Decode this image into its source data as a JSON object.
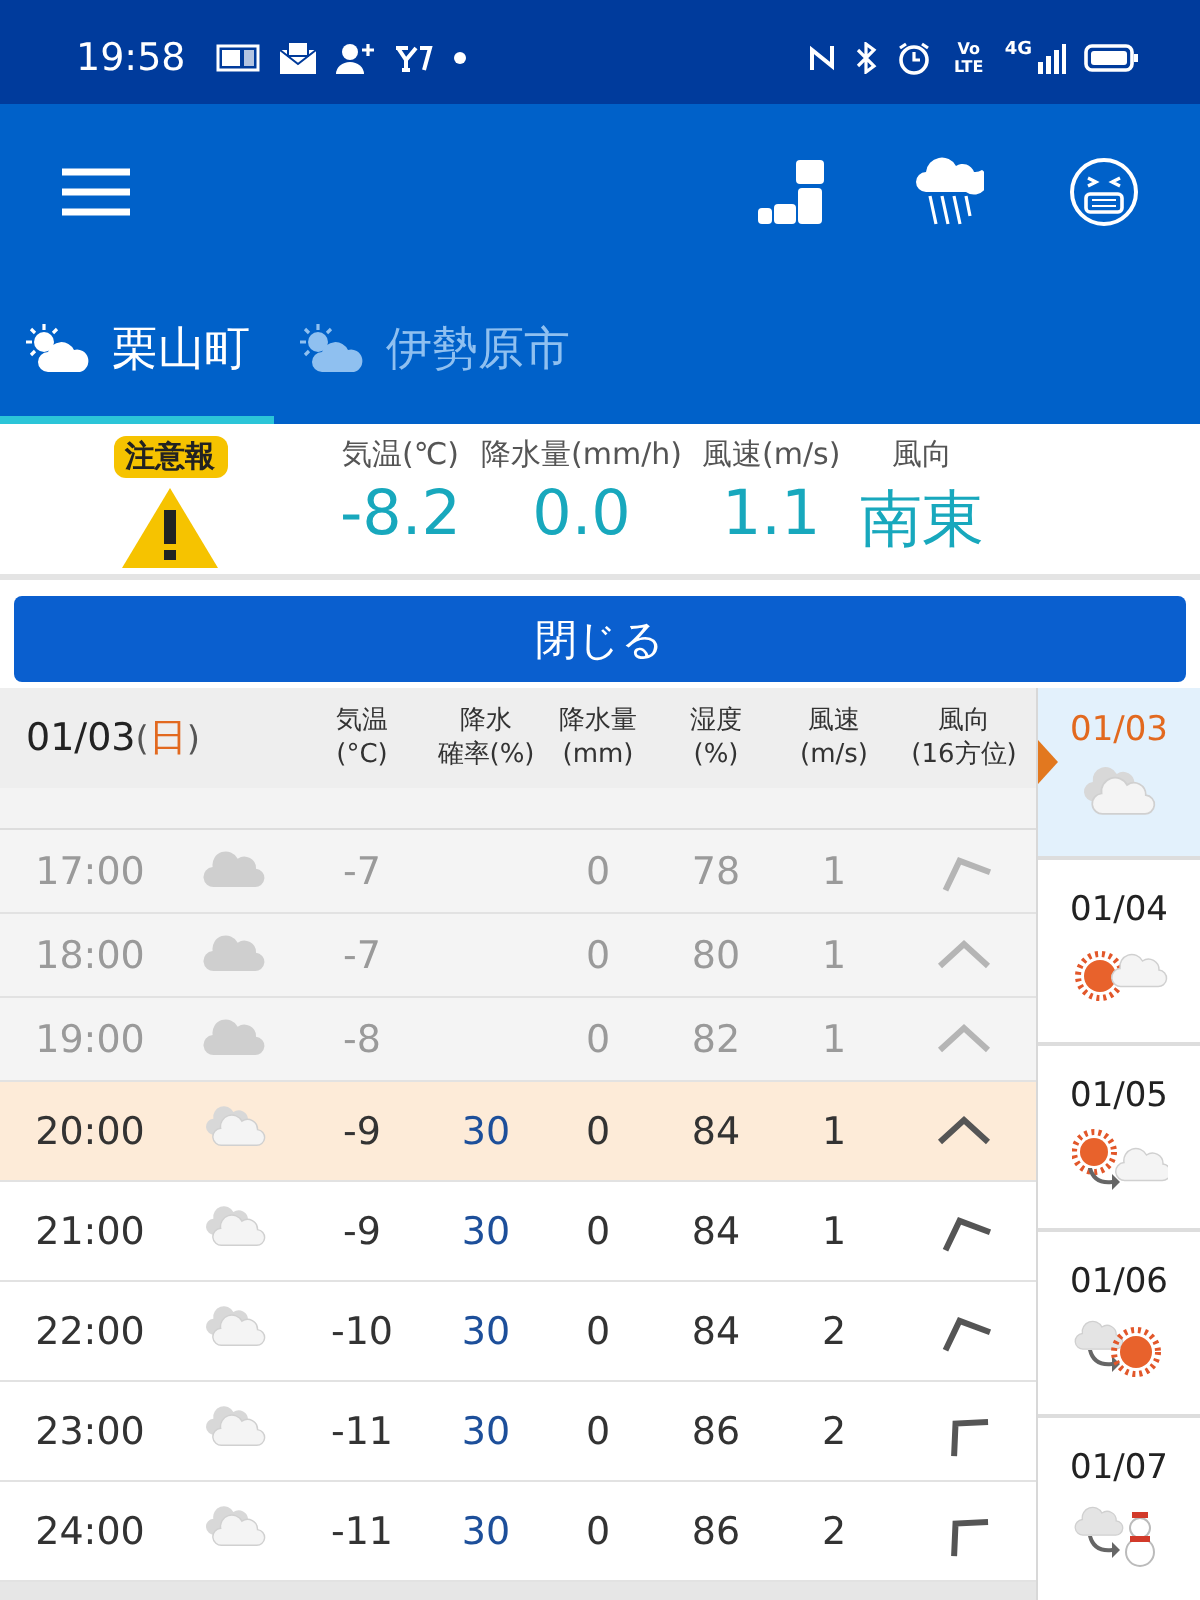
{
  "status_bar": {
    "time": "19:58",
    "network_labels": [
      "Vo LTE",
      "4G"
    ]
  },
  "tabs": [
    {
      "label": "栗山町",
      "selected": true
    },
    {
      "label": "伊勢原市",
      "selected": false
    }
  ],
  "current": {
    "warning_badge": "注意報",
    "readings": [
      {
        "label": "気温(℃)",
        "value": "-8.2"
      },
      {
        "label": "降水量(mm/h)",
        "value": "0.0"
      },
      {
        "label": "風速(m/s)",
        "value": "1.1"
      },
      {
        "label": "風向",
        "value": "南東"
      }
    ]
  },
  "close_button": "閉じる",
  "table": {
    "date": "01/03",
    "weekday_open": "(",
    "weekday": "日",
    "weekday_close": ")",
    "columns": [
      [
        "気温",
        "(°C)"
      ],
      [
        "降水",
        "確率(%)"
      ],
      [
        "降水量",
        "(mm)"
      ],
      [
        "湿度",
        "(%)"
      ],
      [
        "風速",
        "(m/s)"
      ],
      [
        "風向",
        "(16方位)"
      ]
    ],
    "rows": [
      {
        "time": "17:00",
        "weather_icon": {
          "kind": "cloudy"
        },
        "temp": "-7",
        "amount": "0",
        "humidity": "78",
        "wind": "1",
        "wind_arrow": {
          "kind": "nnw"
        },
        "past": true,
        "current": false
      },
      {
        "time": "18:00",
        "weather_icon": {
          "kind": "cloudy"
        },
        "temp": "-7",
        "amount": "0",
        "humidity": "80",
        "wind": "1",
        "wind_arrow": {
          "kind": "n"
        },
        "past": true,
        "current": false
      },
      {
        "time": "19:00",
        "weather_icon": {
          "kind": "cloudy"
        },
        "temp": "-8",
        "amount": "0",
        "humidity": "82",
        "wind": "1",
        "wind_arrow": {
          "kind": "n"
        },
        "past": true,
        "current": false
      },
      {
        "time": "20:00",
        "weather_icon": {
          "kind": "cloudy"
        },
        "temp": "-9",
        "probability": "30",
        "amount": "0",
        "humidity": "84",
        "wind": "1",
        "wind_arrow": {
          "kind": "n"
        },
        "past": false,
        "current": true
      },
      {
        "time": "21:00",
        "weather_icon": {
          "kind": "cloudy"
        },
        "temp": "-9",
        "probability": "30",
        "amount": "0",
        "humidity": "84",
        "wind": "1",
        "wind_arrow": {
          "kind": "nnw"
        },
        "past": false,
        "current": false
      },
      {
        "time": "22:00",
        "weather_icon": {
          "kind": "cloudy"
        },
        "temp": "-10",
        "probability": "30",
        "amount": "0",
        "humidity": "84",
        "wind": "2",
        "wind_arrow": {
          "kind": "nnw"
        },
        "past": false,
        "current": false
      },
      {
        "time": "23:00",
        "weather_icon": {
          "kind": "cloudy"
        },
        "temp": "-11",
        "probability": "30",
        "amount": "0",
        "humidity": "86",
        "wind": "2",
        "wind_arrow": {
          "kind": "nw"
        },
        "past": false,
        "current": false
      },
      {
        "time": "24:00",
        "weather_icon": {
          "kind": "cloudy"
        },
        "temp": "-11",
        "probability": "30",
        "amount": "0",
        "humidity": "86",
        "wind": "2",
        "wind_arrow": {
          "kind": "nw"
        },
        "past": false,
        "current": false
      }
    ]
  },
  "days": [
    {
      "date": "01/03",
      "weather_icon": {
        "kind": "cloudy"
      },
      "selected": true
    },
    {
      "date": "01/04",
      "weather_icon": {
        "kind": "sunny_cloudy"
      },
      "selected": false
    },
    {
      "date": "01/05",
      "weather_icon": {
        "kind": "sun_then_cloud"
      },
      "selected": false
    },
    {
      "date": "01/06",
      "weather_icon": {
        "kind": "cloud_then_sun"
      },
      "selected": false
    },
    {
      "date": "01/07",
      "weather_icon": {
        "kind": "cloud_then_snow"
      },
      "selected": false
    }
  ]
}
